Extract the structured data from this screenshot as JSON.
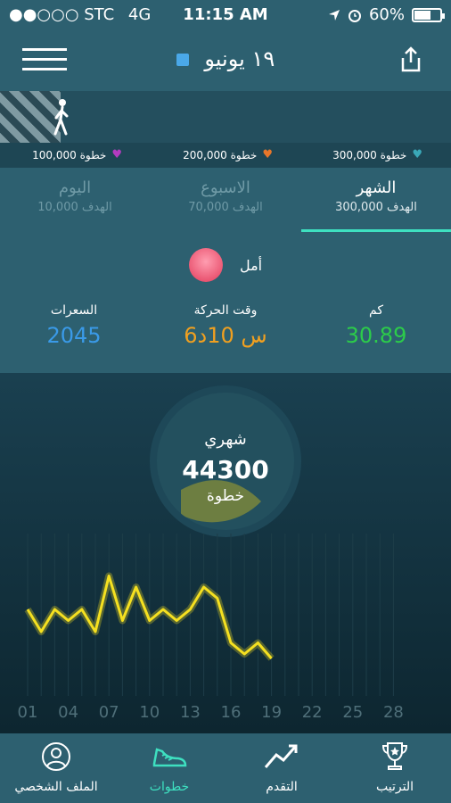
{
  "status_bar": {
    "carrier": "●●○○○ STC",
    "network": "4G",
    "time": "11:15 AM",
    "battery": "60%"
  },
  "header": {
    "date": "١٩ يونيو"
  },
  "milestones": [
    {
      "label": "300,000 خطوة",
      "heart_color": "#3aa8b8"
    },
    {
      "label": "200,000 خطوة",
      "heart_color": "#e8762a"
    },
    {
      "label": "100,000 خطوة",
      "heart_color": "#b43bc0"
    }
  ],
  "tabs": [
    {
      "title": "الشهر",
      "goal": "الهدف 300,000",
      "active": true
    },
    {
      "title": "الاسبوع",
      "goal": "الهدف 70,000",
      "active": false
    },
    {
      "title": "اليوم",
      "goal": "الهدف 10,000",
      "active": false
    }
  ],
  "user": {
    "name": "أمل"
  },
  "stats": [
    {
      "label": "كم",
      "value": "30.89",
      "color": "#2ccc4a"
    },
    {
      "label": "وقت الحركة",
      "value": "6س 10د",
      "color": "#f0a020"
    },
    {
      "label": "السعرات",
      "value": "2045",
      "color": "#3a9ae8"
    }
  ],
  "ring": {
    "label": "شهري",
    "steps": "44300",
    "unit": "خطوة",
    "progress": 0.148
  },
  "chart_data": {
    "type": "line",
    "x": [
      "01",
      "02",
      "03",
      "04",
      "05",
      "06",
      "07",
      "08",
      "09",
      "10",
      "11",
      "12",
      "13",
      "14",
      "15",
      "16",
      "17",
      "18",
      "19"
    ],
    "x_ticks": [
      "01",
      "04",
      "07",
      "10",
      "13",
      "16",
      "19",
      "22",
      "25",
      "28"
    ],
    "values": [
      3000,
      2000,
      3000,
      2500,
      3000,
      2000,
      4500,
      2500,
      4000,
      2500,
      3000,
      2500,
      3000,
      4000,
      3500,
      1500,
      1000,
      1500,
      800
    ],
    "xlim": [
      1,
      28
    ],
    "color": "#f5e020"
  },
  "tabbar": [
    {
      "label": "الترتيب",
      "icon": "trophy-icon",
      "active": false
    },
    {
      "label": "التقدم",
      "icon": "trend-up-icon",
      "active": false
    },
    {
      "label": "خطوات",
      "icon": "sneaker-icon",
      "active": true
    },
    {
      "label": "الملف الشخصي",
      "icon": "profile-icon",
      "active": false
    }
  ]
}
